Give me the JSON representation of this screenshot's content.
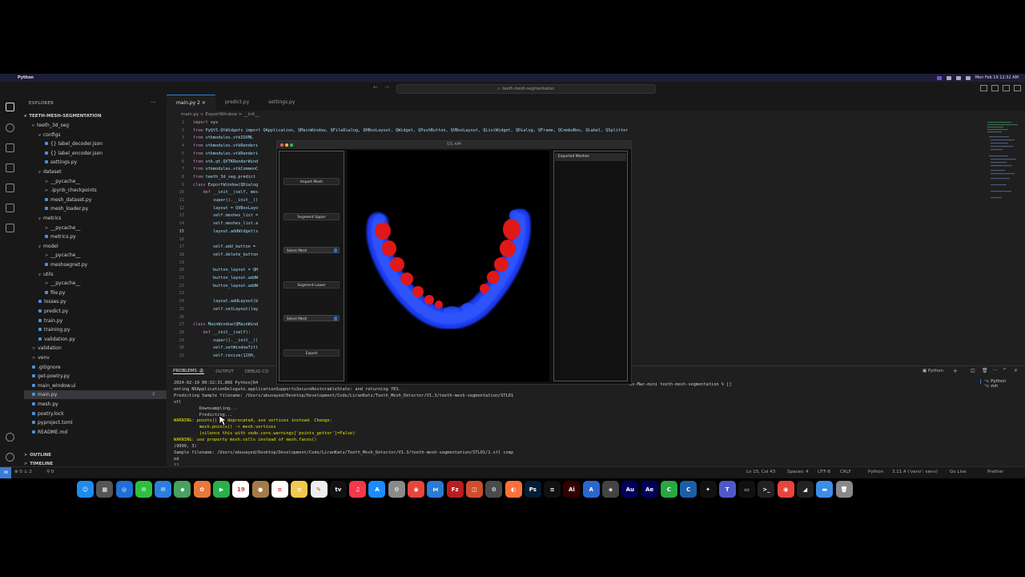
{
  "menubar": {
    "app_name": "Python",
    "datetime": "Mon Feb 19  12:32 AM"
  },
  "window": {
    "title": "teeth-mesh-segmentation"
  },
  "sidebar": {
    "header": "EXPLORER",
    "project": "TEETH-MESH-SEGMENTATION",
    "items": [
      {
        "label": "teeth_3d_seg",
        "indent": 1,
        "caret": "v"
      },
      {
        "label": "configs",
        "indent": 2,
        "caret": "v"
      },
      {
        "label": "{} label_decoder.json",
        "indent": 3,
        "caret": ""
      },
      {
        "label": "{} label_encoder.json",
        "indent": 3,
        "caret": ""
      },
      {
        "label": "settings.py",
        "indent": 3,
        "caret": ""
      },
      {
        "label": "dataset",
        "indent": 2,
        "caret": "v"
      },
      {
        "label": "__pycache__",
        "indent": 3,
        "caret": ">"
      },
      {
        "label": ".ipynb_checkpoints",
        "indent": 3,
        "caret": ">"
      },
      {
        "label": "mesh_dataset.py",
        "indent": 3,
        "caret": ""
      },
      {
        "label": "mesh_loader.py",
        "indent": 3,
        "caret": ""
      },
      {
        "label": "metrics",
        "indent": 2,
        "caret": "v"
      },
      {
        "label": "__pycache__",
        "indent": 3,
        "caret": ">"
      },
      {
        "label": "metrics.py",
        "indent": 3,
        "caret": ""
      },
      {
        "label": "model",
        "indent": 2,
        "caret": "v"
      },
      {
        "label": "__pycache__",
        "indent": 3,
        "caret": ">"
      },
      {
        "label": "meshsegnet.py",
        "indent": 3,
        "caret": ""
      },
      {
        "label": "utils",
        "indent": 2,
        "caret": "v"
      },
      {
        "label": "__pycache__",
        "indent": 3,
        "caret": ">"
      },
      {
        "label": "file.py",
        "indent": 3,
        "caret": ""
      },
      {
        "label": "losses.py",
        "indent": 2,
        "caret": ""
      },
      {
        "label": "predict.py",
        "indent": 2,
        "caret": ""
      },
      {
        "label": "train.py",
        "indent": 2,
        "caret": ""
      },
      {
        "label": "training.py",
        "indent": 2,
        "caret": ""
      },
      {
        "label": "validation.py",
        "indent": 2,
        "caret": ""
      },
      {
        "label": "validation",
        "indent": 1,
        "caret": ">"
      },
      {
        "label": "venv",
        "indent": 1,
        "caret": ">"
      },
      {
        "label": ".gitignore",
        "indent": 1,
        "caret": ""
      },
      {
        "label": "get-poetry.py",
        "indent": 1,
        "caret": ""
      },
      {
        "label": "main_window.ui",
        "indent": 1,
        "caret": ""
      },
      {
        "label": "main.py",
        "indent": 1,
        "caret": "",
        "badge": "2"
      },
      {
        "label": "mesh.py",
        "indent": 1,
        "caret": ""
      },
      {
        "label": "poetry.lock",
        "indent": 1,
        "caret": ""
      },
      {
        "label": "pyproject.toml",
        "indent": 1,
        "caret": ""
      },
      {
        "label": "README.md",
        "indent": 1,
        "caret": ""
      }
    ],
    "outline": "OUTLINE",
    "timeline": "TIMELINE"
  },
  "tabs": [
    {
      "label": "main.py 2"
    },
    {
      "label": "predict.py"
    },
    {
      "label": "settings.py"
    }
  ],
  "breadcrumb": "main.py > ExportWindow > __init__",
  "code_lines": [
    {
      "n": "1",
      "kw": "import",
      "rest": " sys"
    },
    {
      "n": "2",
      "kw": "from",
      "rest": " PyQt5.QtWidgets import QApplication, QMainWindow, QFileDialog, QHBoxLayout, QWidget, QPushButton, QVBoxLayout, QListWidget, QDialog, QFrame, QComboBox, QLabel, QSplitter"
    },
    {
      "n": "3",
      "kw": "from",
      "rest": " vtkmodules.vtkIOXML"
    },
    {
      "n": "4",
      "kw": "from",
      "rest": " vtkmodules.vtkRenderi"
    },
    {
      "n": "5",
      "kw": "from",
      "rest": " vtkmodules.vtkRenderi"
    },
    {
      "n": "6",
      "kw": "from",
      "rest": " vtk.qt.QVTKRenderWind"
    },
    {
      "n": "7",
      "kw": "from",
      "rest": " vtkmodules.vtkCommonC"
    },
    {
      "n": "8",
      "kw": "from",
      "rest": " teeth_3d_seg.predict"
    },
    {
      "n": "9",
      "kw": "class",
      "rest": " ExportWindow(QDialog"
    },
    {
      "n": "10",
      "kw": "    def",
      "rest": " __init__(self, mes"
    },
    {
      "n": "11",
      "kw": "",
      "rest": "        super().__init__()"
    },
    {
      "n": "12",
      "kw": "",
      "rest": "        layout = QVBoxLayo"
    },
    {
      "n": "13",
      "kw": "",
      "rest": "        self.meshes_list ="
    },
    {
      "n": "14",
      "kw": "",
      "rest": "        self.meshes_list.a"
    },
    {
      "n": "15",
      "kw": "",
      "rest": "        layout.addWidget(s"
    },
    {
      "n": "16",
      "kw": "",
      "rest": ""
    },
    {
      "n": "17",
      "kw": "",
      "rest": "        self.add_button ="
    },
    {
      "n": "18",
      "kw": "",
      "rest": "        self.delete_button"
    },
    {
      "n": "19",
      "kw": "",
      "rest": ""
    },
    {
      "n": "20",
      "kw": "",
      "rest": "        button_layout = QH"
    },
    {
      "n": "21",
      "kw": "",
      "rest": "        button_layout.addW"
    },
    {
      "n": "22",
      "kw": "",
      "rest": "        button_layout.addW"
    },
    {
      "n": "23",
      "kw": "",
      "rest": ""
    },
    {
      "n": "24",
      "kw": "",
      "rest": "        layout.addLayout(b"
    },
    {
      "n": "25",
      "kw": "",
      "rest": "        self.setLayout(lay"
    },
    {
      "n": "26",
      "kw": "",
      "rest": ""
    },
    {
      "n": "27",
      "kw": "class",
      "rest": " MainWindow(QMainWind"
    },
    {
      "n": "28",
      "kw": "    def",
      "rest": " __init__(self):"
    },
    {
      "n": "29",
      "kw": "",
      "rest": "        super().__init__()"
    },
    {
      "n": "30",
      "kw": "",
      "rest": "        self.setWindowTitl"
    },
    {
      "n": "31",
      "kw": "",
      "rest": "        self.resize(1200,"
    }
  ],
  "panel": {
    "tabs": [
      "PROBLEMS",
      "2",
      "OUTPUT",
      "DEBUG CO"
    ],
    "terminals": [
      "Python",
      "zsh"
    ],
    "prompt_tail": "us-Mac-mini teeth-mesh-segmentation % []",
    "lines": [
      {
        "text": "2024-02-19 00:32:31.866 Python[64",
        "warn": false
      },
      {
        "text": "enting NSApplicationDelegate.applicationSupportsSecureRestorableState: and returning YES.",
        "warn": false
      },
      {
        "text": "Predicting Sample filename: /Users/abusayed/Desktop/Development/Code/LiranKatz/Teeth_Mesh_Detector/V1.3/teeth-mesh-segmentation/STL01",
        "warn": false
      },
      {
        "text": "stl",
        "warn": false
      },
      {
        "text": "          Downsampling...",
        "warn": false
      },
      {
        "text": "          Predicting...",
        "warn": false
      },
      {
        "text": "WARNING: points() is deprecated, use vertices instead. Change:",
        "warn": true
      },
      {
        "text": "          mesh.points() -> mesh.vertices",
        "warn": true
      },
      {
        "text": "          (silence this with vedo.core.warnings['points_getter']=False)",
        "warn": true
      },
      {
        "text": "WARNING: use property mesh.cells instead of mesh.faces()",
        "warn": true
      },
      {
        "text": "(9999, 3)",
        "warn": false
      },
      {
        "text": "Sample filename: /Users/abusayed/Desktop/Development/Code/LiranKatz/Teeth_Mesh_Detector/V1.3/teeth-mesh-segmentation/STL01/1.stl comp",
        "warn": false
      },
      {
        "text": "ed",
        "warn": false
      },
      {
        "text": "[]",
        "warn": false
      }
    ]
  },
  "statusbar": {
    "errors": "⊗ 0 ⚠ 2",
    "ports": "⚲ 0",
    "position": "Ln 15, Col 43",
    "spaces": "Spaces: 4",
    "encoding": "UTF-8",
    "eol": "CRLF",
    "language": "Python",
    "interpreter": "3.11.4 ('venv': venv)",
    "golive": "Go Live",
    "prettier": "Prettier"
  },
  "stl_app": {
    "title": "STL APP",
    "buttons": {
      "import": "Import Mesh",
      "seg_upper": "Segment Upper",
      "select1": "Select Mesh",
      "seg_lower": "Segment Lower",
      "select2": "Select Mesh",
      "export": "Export"
    },
    "exported_header": "Exported Meshes"
  },
  "dock": [
    {
      "name": "finder-icon",
      "color": "#1d8cf0",
      "glyph": "☺"
    },
    {
      "name": "launchpad-icon",
      "color": "#555",
      "glyph": "▦"
    },
    {
      "name": "safari-icon",
      "color": "#1f6fd6",
      "glyph": "◎"
    },
    {
      "name": "messages-icon",
      "color": "#2fbf3f",
      "glyph": "✉"
    },
    {
      "name": "mail-icon",
      "color": "#2a7de1",
      "glyph": "✉"
    },
    {
      "name": "maps-icon",
      "color": "#48a160",
      "glyph": "◆"
    },
    {
      "name": "photos-icon",
      "color": "#e7783a",
      "glyph": "✿"
    },
    {
      "name": "facetime-icon",
      "color": "#28b14a",
      "glyph": "▶"
    },
    {
      "name": "calendar-icon",
      "color": "#ffffff",
      "glyph": "19"
    },
    {
      "name": "contacts-icon",
      "color": "#a57a4a",
      "glyph": "●"
    },
    {
      "name": "reminders-icon",
      "color": "#ffffff",
      "glyph": "≡"
    },
    {
      "name": "notes-icon",
      "color": "#f2c94c",
      "glyph": "≡"
    },
    {
      "name": "freeform-icon",
      "color": "#eeeeee",
      "glyph": "✎"
    },
    {
      "name": "appletv-icon",
      "color": "#111111",
      "glyph": "tv"
    },
    {
      "name": "music-icon",
      "color": "#f2384a",
      "glyph": "♫"
    },
    {
      "name": "appstore-icon",
      "color": "#1a8cff",
      "glyph": "A"
    },
    {
      "name": "settings-icon",
      "color": "#8a8a8a",
      "glyph": "⚙"
    },
    {
      "name": "chrome-icon",
      "color": "#e8453c",
      "glyph": "◉"
    },
    {
      "name": "vscode-icon",
      "color": "#2a7ad6",
      "glyph": "⋈"
    },
    {
      "name": "filezilla-icon",
      "color": "#b91d1d",
      "glyph": "Fz"
    },
    {
      "name": "office-icon",
      "color": "#d14d2b",
      "glyph": "◫"
    },
    {
      "name": "utility-icon",
      "color": "#4b4b4b",
      "glyph": "⚙"
    },
    {
      "name": "firefox-icon",
      "color": "#ff7139",
      "glyph": "◐"
    },
    {
      "name": "photoshop-icon",
      "color": "#001e36",
      "glyph": "Ps"
    },
    {
      "name": "pdf-icon",
      "color": "#111111",
      "glyph": "≡"
    },
    {
      "name": "illustrator-icon",
      "color": "#330000",
      "glyph": "Ai"
    },
    {
      "name": "xcode-icon",
      "color": "#2a66d0",
      "glyph": "A"
    },
    {
      "name": "unity-icon",
      "color": "#444444",
      "glyph": "◈"
    },
    {
      "name": "audition-icon",
      "color": "#00005b",
      "glyph": "Au"
    },
    {
      "name": "aftereffects-icon",
      "color": "#00005b",
      "glyph": "Ae"
    },
    {
      "name": "sheets-icon",
      "color": "#29a745",
      "glyph": "C"
    },
    {
      "name": "c-icon",
      "color": "#1c5fa8",
      "glyph": "C"
    },
    {
      "name": "figma-icon",
      "color": "#111111",
      "glyph": "✦"
    },
    {
      "name": "teams-icon",
      "color": "#5059c9",
      "glyph": "T"
    },
    {
      "name": "preview-icon",
      "color": "#111111",
      "glyph": "▭"
    },
    {
      "name": "terminal-icon",
      "color": "#222222",
      "glyph": ">_"
    },
    {
      "name": "chrome2-icon",
      "color": "#e8453c",
      "glyph": "◉"
    },
    {
      "name": "monitor-icon",
      "color": "#222222",
      "glyph": "◢"
    },
    {
      "name": "folder-icon",
      "color": "#3b8ee8",
      "glyph": "▬"
    },
    {
      "name": "trash-icon",
      "color": "#888888",
      "glyph": "🗑"
    }
  ],
  "colors": {
    "accent": "#3a7bd5",
    "teeth_red": "#e01818",
    "gum_blue": "#1a3cff",
    "warning": "#e5e510"
  }
}
